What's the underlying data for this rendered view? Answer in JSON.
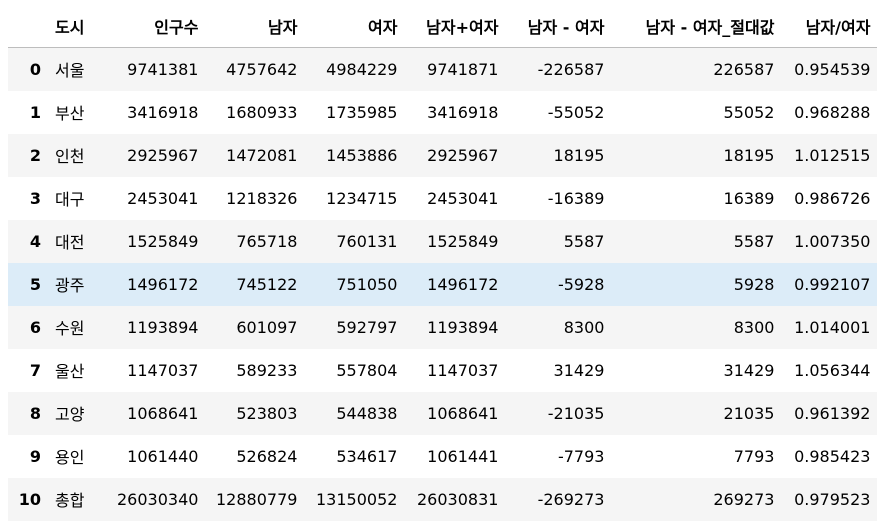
{
  "table": {
    "columns": [
      "",
      "도시",
      "인구수",
      "남자",
      "여자",
      "남자+여자",
      "남자 - 여자",
      "남자 - 여자_절대값",
      "남자/여자"
    ],
    "rows": [
      {
        "index": "0",
        "city": "서울",
        "population": "9741381",
        "male": "4757642",
        "female": "4984229",
        "sum": "9741871",
        "diff": "-226587",
        "abs_diff": "226587",
        "ratio": "0.954539"
      },
      {
        "index": "1",
        "city": "부산",
        "population": "3416918",
        "male": "1680933",
        "female": "1735985",
        "sum": "3416918",
        "diff": "-55052",
        "abs_diff": "55052",
        "ratio": "0.968288"
      },
      {
        "index": "2",
        "city": "인천",
        "population": "2925967",
        "male": "1472081",
        "female": "1453886",
        "sum": "2925967",
        "diff": "18195",
        "abs_diff": "18195",
        "ratio": "1.012515"
      },
      {
        "index": "3",
        "city": "대구",
        "population": "2453041",
        "male": "1218326",
        "female": "1234715",
        "sum": "2453041",
        "diff": "-16389",
        "abs_diff": "16389",
        "ratio": "0.986726"
      },
      {
        "index": "4",
        "city": "대전",
        "population": "1525849",
        "male": "765718",
        "female": "760131",
        "sum": "1525849",
        "diff": "5587",
        "abs_diff": "5587",
        "ratio": "1.007350"
      },
      {
        "index": "5",
        "city": "광주",
        "population": "1496172",
        "male": "745122",
        "female": "751050",
        "sum": "1496172",
        "diff": "-5928",
        "abs_diff": "5928",
        "ratio": "0.992107"
      },
      {
        "index": "6",
        "city": "수원",
        "population": "1193894",
        "male": "601097",
        "female": "592797",
        "sum": "1193894",
        "diff": "8300",
        "abs_diff": "8300",
        "ratio": "1.014001"
      },
      {
        "index": "7",
        "city": "울산",
        "population": "1147037",
        "male": "589233",
        "female": "557804",
        "sum": "1147037",
        "diff": "31429",
        "abs_diff": "31429",
        "ratio": "1.056344"
      },
      {
        "index": "8",
        "city": "고양",
        "population": "1068641",
        "male": "523803",
        "female": "544838",
        "sum": "1068641",
        "diff": "-21035",
        "abs_diff": "21035",
        "ratio": "0.961392"
      },
      {
        "index": "9",
        "city": "용인",
        "population": "1061440",
        "male": "526824",
        "female": "534617",
        "sum": "1061441",
        "diff": "-7793",
        "abs_diff": "7793",
        "ratio": "0.985423"
      },
      {
        "index": "10",
        "city": "총합",
        "population": "26030340",
        "male": "12880779",
        "female": "13150052",
        "sum": "26030831",
        "diff": "-269273",
        "abs_diff": "269273",
        "ratio": "0.979523"
      }
    ],
    "hovered_row_index": "5"
  },
  "colors": {
    "header_border": "#bdbdbd",
    "row_odd_bg": "#f5f5f5",
    "row_even_bg": "#ffffff",
    "row_hover_bg": "#dcecf8",
    "text": "#000000"
  }
}
